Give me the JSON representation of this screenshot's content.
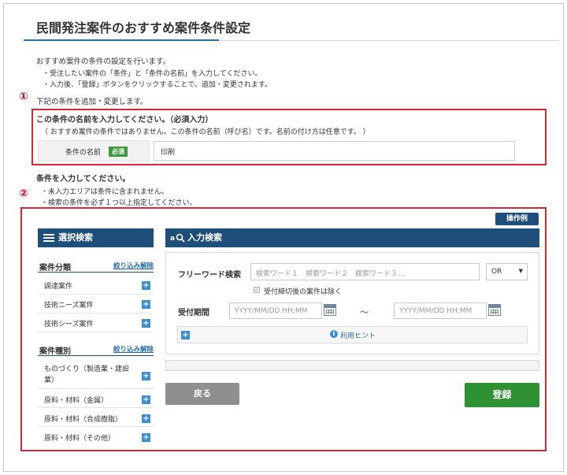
{
  "page_title": "民間発注案件のおすすめ案件条件設定",
  "intro": {
    "line1": "おすすめ案件の条件の設定を行います。",
    "line2": "・受注したい案件の「条件」と「条件の名前」を入力してください。",
    "line3": "・入力後、「登録」ボタンをクリックすることで、追加・変更されます。",
    "line4": "下記の条件を追加・変更します。"
  },
  "markers": {
    "one": "①",
    "two": "②"
  },
  "name_section": {
    "heading": "この条件の名前を入力してください。（必須入力）",
    "note": "（ おすすめ案件の条件ではありません。この条件の名前（呼び名）です。名前の付け方は任意です。 ）",
    "field_label": "条件の名前",
    "required_badge": "必須",
    "value": "印刷"
  },
  "condition_section": {
    "heading": "条件を入力してください。",
    "note1": "・未入力エリアは条件に含まれません。",
    "note2": "・検索の条件を必ず１つ以上指定してください。"
  },
  "operation_example": "操作例",
  "select_search": {
    "title": "選択検索",
    "groups": [
      {
        "heading": "案件分類",
        "filter_link": "絞り込み解除",
        "items": [
          "調達案件",
          "技術ニーズ案件",
          "技術シーズ案件"
        ]
      },
      {
        "heading": "案件種別",
        "filter_link": "絞り込み解除",
        "items": [
          "ものづくり（製造業・建設業）",
          "原料・材料（金属）",
          "原料・材料（合成樹脂）",
          "原料・材料（その他）"
        ]
      }
    ]
  },
  "input_search": {
    "title": "入力検索",
    "freeword_label": "フリーワード検索",
    "freeword_placeholder": "検索ワード１　検索ワード２　検索ワード３...",
    "operator": "OR",
    "exclude_closed": "受付締切後の案件は除く",
    "period_label": "受付期間",
    "date_placeholder": "YYYY/MM/DD HH:MM",
    "tilde": "～",
    "hint": "利用ヒント"
  },
  "buttons": {
    "back": "戻る",
    "register": "登録"
  },
  "colors": {
    "accent": "#1d4f7a",
    "marker_red": "#d6263a",
    "register_green": "#2e9234",
    "plus_blue": "#3b8fd0"
  }
}
